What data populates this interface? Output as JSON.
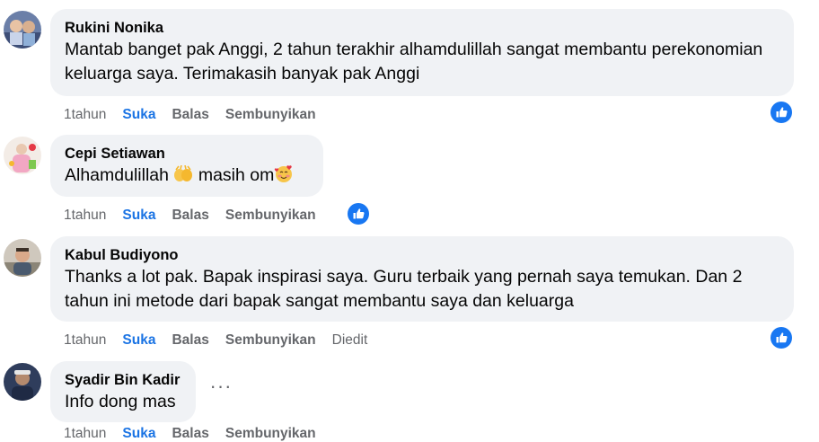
{
  "comments": [
    {
      "author": "Rukini Nonika",
      "text": "Mantab banget pak Anggi, 2 tahun terakhir alhamdulillah sangat membantu perekonomian keluarga saya. Terimakasih banyak pak Anggi",
      "actions": {
        "time": "1tahun",
        "like": "Suka",
        "reply": "Balas",
        "hide": "Sembunyikan"
      },
      "reaction_icon": "like-reaction-icon"
    },
    {
      "author": "Cepi Setiawan",
      "text_before": "Alhamdulillah",
      "text_middle": "masih om",
      "actions": {
        "time": "1tahun",
        "like": "Suka",
        "reply": "Balas",
        "hide": "Sembunyikan"
      },
      "reaction_icon": "like-reaction-icon"
    },
    {
      "author": "Kabul Budiyono",
      "text": "Thanks a lot pak. Bapak inspirasi saya. Guru terbaik yang pernah saya temukan. Dan 2 tahun ini metode dari bapak sangat membantu saya dan keluarga",
      "actions": {
        "time": "1tahun",
        "like": "Suka",
        "reply": "Balas",
        "hide": "Sembunyikan",
        "edited": "Diedit"
      },
      "reaction_icon": "like-reaction-icon"
    },
    {
      "author": "Syadir Bin Kadir",
      "text": "Info dong mas",
      "actions": {
        "time": "1tahun",
        "like": "Suka",
        "reply": "Balas",
        "hide": "Sembunyikan"
      },
      "more_label": "···"
    }
  ],
  "colors": {
    "bubble": "#f0f2f5",
    "like_blue": "#1b74e4",
    "meta_gray": "#65676b",
    "text": "#050505"
  }
}
